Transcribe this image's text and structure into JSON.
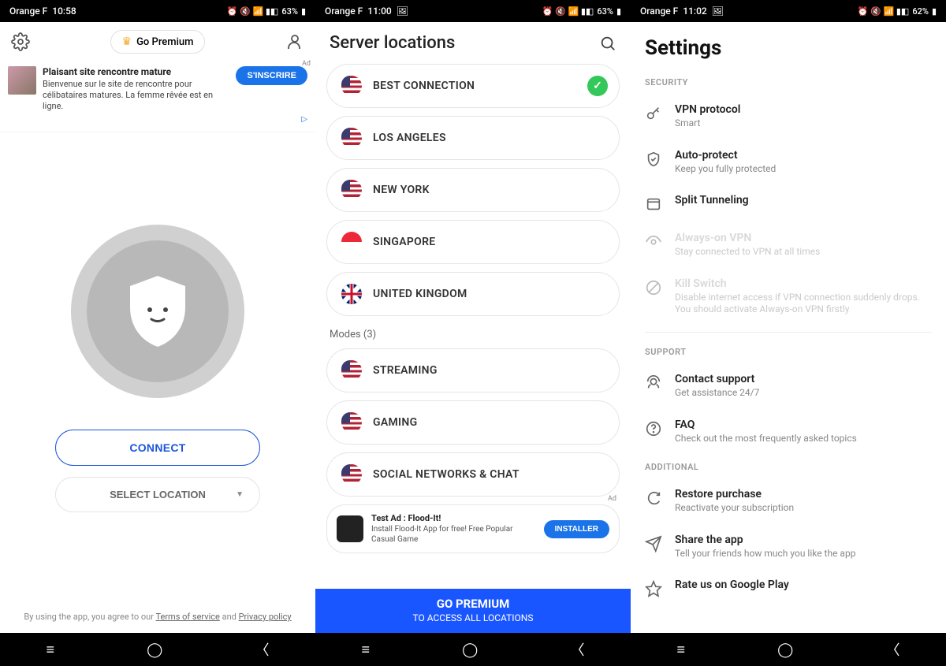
{
  "screen1": {
    "status": {
      "carrier": "Orange F",
      "time": "10:58",
      "battery": "63%"
    },
    "header": {
      "premium_label": "Go Premium"
    },
    "ad": {
      "label": "Ad",
      "title": "Plaisant site rencontre mature",
      "desc": "Bienvenue sur le site de rencontre pour célibataires matures. La femme rêvée est en ligne.",
      "button": "S'INSCRIRE"
    },
    "connect_label": "CONNECT",
    "location_label": "SELECT LOCATION",
    "terms_prefix": "By using the app, you agree to our ",
    "terms": "Terms of service",
    "terms_mid": " and ",
    "privacy": "Privacy policy"
  },
  "screen2": {
    "status": {
      "carrier": "Orange F",
      "time": "11:00",
      "battery": "63%"
    },
    "title": "Server locations",
    "servers": [
      {
        "name": "BEST CONNECTION",
        "flag": "us",
        "selected": true
      },
      {
        "name": "LOS ANGELES",
        "flag": "us"
      },
      {
        "name": "NEW YORK",
        "flag": "us"
      },
      {
        "name": "SINGAPORE",
        "flag": "sg"
      },
      {
        "name": "UNITED KINGDOM",
        "flag": "uk"
      }
    ],
    "modes_label": "Modes (3)",
    "modes": [
      {
        "name": "STREAMING",
        "flag": "us"
      },
      {
        "name": "GAMING",
        "flag": "us"
      },
      {
        "name": "SOCIAL NETWORKS & CHAT",
        "flag": "us"
      }
    ],
    "ad": {
      "label": "Ad",
      "title": "Test Ad : Flood-It!",
      "desc": "Install Flood-It App for free! Free Popular Casual Game",
      "button": "INSTALLER"
    },
    "premium_bar": {
      "title": "GO PREMIUM",
      "sub": "TO ACCESS ALL LOCATIONS"
    }
  },
  "screen3": {
    "status": {
      "carrier": "Orange F",
      "time": "11:02",
      "battery": "62%"
    },
    "title": "Settings",
    "sections": {
      "security": {
        "label": "SECURITY",
        "items": [
          {
            "title": "VPN protocol",
            "desc": "Smart",
            "icon": "key"
          },
          {
            "title": "Auto-protect",
            "desc": "Keep you fully protected",
            "icon": "shield"
          },
          {
            "title": "Split Tunneling",
            "desc": "",
            "icon": "window"
          },
          {
            "title": "Always-on VPN",
            "desc": "Stay connected to VPN at all times",
            "icon": "eye",
            "disabled": true
          },
          {
            "title": "Kill Switch",
            "desc": "Disable internet access if VPN connection suddenly drops. You should activate Always-on VPN firstly",
            "icon": "block",
            "disabled": true
          }
        ]
      },
      "support": {
        "label": "SUPPORT",
        "items": [
          {
            "title": "Contact support",
            "desc": "Get assistance 24/7",
            "icon": "headset"
          },
          {
            "title": "FAQ",
            "desc": "Check out the most frequently asked topics",
            "icon": "help"
          }
        ]
      },
      "additional": {
        "label": "ADDITIONAL",
        "items": [
          {
            "title": "Restore purchase",
            "desc": "Reactivate your subscription",
            "icon": "restore"
          },
          {
            "title": "Share the app",
            "desc": "Tell your friends how much you like the app",
            "icon": "send"
          },
          {
            "title": "Rate us on Google Play",
            "desc": "",
            "icon": "star"
          }
        ]
      }
    }
  }
}
